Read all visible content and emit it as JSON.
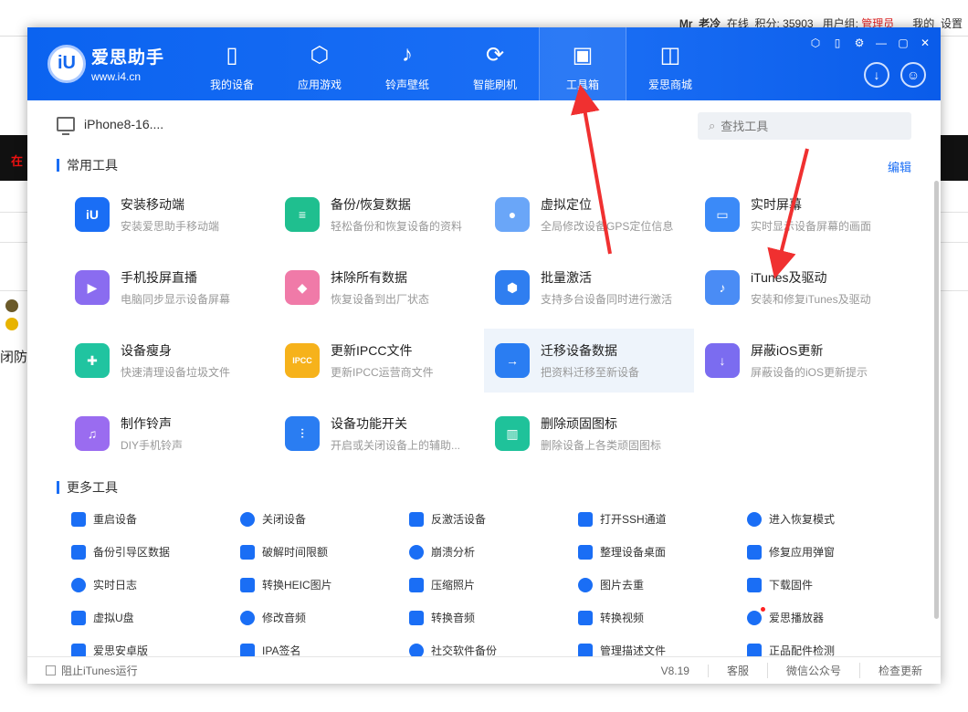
{
  "background": {
    "user_name": "Mr_老冷",
    "online": "在线",
    "points_label": "积分: 35903",
    "group_label": "用户组:",
    "group_value": "管理员",
    "my": "我的",
    "settings": "设置",
    "left_text": "闭防",
    "band_text": "在"
  },
  "app": {
    "name": "爱思助手",
    "url": "www.i4.cn",
    "nav": [
      {
        "label": "我的设备",
        "icon": "phone-icon"
      },
      {
        "label": "应用游戏",
        "icon": "cube-icon"
      },
      {
        "label": "铃声壁纸",
        "icon": "music-folder-icon"
      },
      {
        "label": "智能刷机",
        "icon": "shield-refresh-icon"
      },
      {
        "label": "工具箱",
        "icon": "toolbox-icon"
      },
      {
        "label": "爱思商城",
        "icon": "shopping-bag-icon"
      }
    ],
    "active_nav": "工具箱",
    "accent": "#1a6ef5"
  },
  "device": {
    "name": "iPhone8-16...."
  },
  "search": {
    "placeholder": "查找工具"
  },
  "common": {
    "title": "常用工具",
    "edit": "编辑",
    "tools": [
      {
        "title": "安装移动端",
        "desc": "安装爱思助手移动端",
        "color": "#1a6ef5",
        "glyph": "iU"
      },
      {
        "title": "备份/恢复数据",
        "desc": "轻松备份和恢复设备的资料",
        "color": "#1fbf8f",
        "glyph": "≡"
      },
      {
        "title": "虚拟定位",
        "desc": "全局修改设备GPS定位信息",
        "color": "#6aa6f8",
        "glyph": "●"
      },
      {
        "title": "实时屏幕",
        "desc": "实时显示设备屏幕的画面",
        "color": "#3b8af8",
        "glyph": "▭"
      },
      {
        "title": "手机投屏直播",
        "desc": "电脑同步显示设备屏幕",
        "color": "#8a6cf0",
        "glyph": "▶"
      },
      {
        "title": "抹除所有数据",
        "desc": "恢复设备到出厂状态",
        "color": "#f07aa8",
        "glyph": "◆"
      },
      {
        "title": "批量激活",
        "desc": "支持多台设备同时进行激活",
        "color": "#2f7ef0",
        "glyph": "⬢"
      },
      {
        "title": "iTunes及驱动",
        "desc": "安装和修复iTunes及驱动",
        "color": "#4a8cf5",
        "glyph": "♪"
      },
      {
        "title": "设备瘦身",
        "desc": "快速清理设备垃圾文件",
        "color": "#20c4a0",
        "glyph": "✚"
      },
      {
        "title": "更新IPCC文件",
        "desc": "更新IPCC运营商文件",
        "color": "#f6b21b",
        "glyph": "IPCC"
      },
      {
        "title": "迁移设备数据",
        "desc": "把资料迁移至新设备",
        "color": "#2a7df2",
        "glyph": "→"
      },
      {
        "title": "屏蔽iOS更新",
        "desc": "屏蔽设备的iOS更新提示",
        "color": "#7b6cf0",
        "glyph": "↓"
      },
      {
        "title": "制作铃声",
        "desc": "DIY手机铃声",
        "color": "#9a6cf0",
        "glyph": "♫"
      },
      {
        "title": "设备功能开关",
        "desc": "开启或关闭设备上的辅助...",
        "color": "#2a7df2",
        "glyph": "⫶"
      },
      {
        "title": "删除顽固图标",
        "desc": "删除设备上各类顽固图标",
        "color": "#1fc29a",
        "glyph": "▥"
      }
    ]
  },
  "more": {
    "title": "更多工具",
    "items": [
      "重启设备",
      "关闭设备",
      "反激活设备",
      "打开SSH通道",
      "进入恢复模式",
      "备份引导区数据",
      "破解时间限额",
      "崩溃分析",
      "整理设备桌面",
      "修复应用弹窗",
      "实时日志",
      "转换HEIC图片",
      "压缩照片",
      "图片去重",
      "下载固件",
      "虚拟U盘",
      "修改音频",
      "转换音频",
      "转换视频",
      "爱思播放器",
      "爱思安卓版",
      "IPA签名",
      "社交软件备份",
      "管理描述文件",
      "正品配件检测"
    ]
  },
  "footer": {
    "block_itunes": "阻止iTunes运行",
    "version": "V8.19",
    "service": "客服",
    "wechat": "微信公众号",
    "update": "检查更新"
  }
}
